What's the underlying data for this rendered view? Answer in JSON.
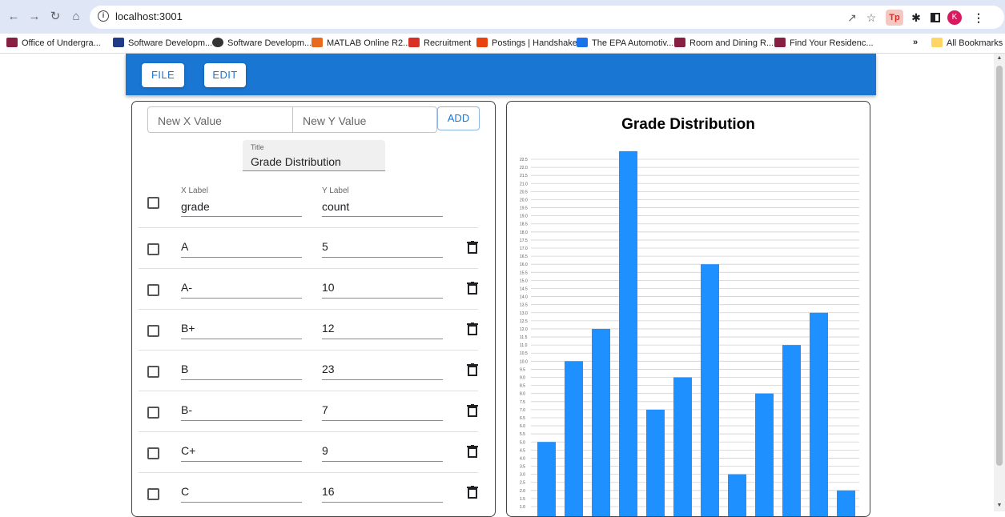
{
  "browser": {
    "url": "localhost:3001",
    "bookmarks": [
      {
        "label": "Office of Undergra...",
        "color": "#861f41"
      },
      {
        "label": "Software Developm...",
        "color": "#1f3c88"
      },
      {
        "label": "Software Developm...",
        "color": "#333333"
      },
      {
        "label": "MATLAB Online R2...",
        "color": "#e76a1f"
      },
      {
        "label": "Recruitment",
        "color": "#d93025"
      },
      {
        "label": "Postings | Handshake",
        "color": "#e8430f"
      },
      {
        "label": "The EPA Automotiv...",
        "color": "#1a73e8"
      },
      {
        "label": "Room and Dining R...",
        "color": "#861f41"
      },
      {
        "label": "Find Your Residenc...",
        "color": "#861f41"
      }
    ],
    "all_bookmarks": "All Bookmarks",
    "profile_initial": "K"
  },
  "appbar": {
    "file_label": "FILE",
    "edit_label": "EDIT",
    "color": "#1976d2"
  },
  "editor": {
    "x_placeholder": "New X Value",
    "y_placeholder": "New Y Value",
    "add_label": "ADD",
    "title_label": "Title",
    "title_value": "Grade Distribution",
    "x_label_caption": "X Label",
    "x_label_value": "grade",
    "y_label_caption": "Y Label",
    "y_label_value": "count",
    "rows": [
      {
        "x": "A",
        "y": "5"
      },
      {
        "x": "A-",
        "y": "10"
      },
      {
        "x": "B+",
        "y": "12"
      },
      {
        "x": "B",
        "y": "23"
      },
      {
        "x": "B-",
        "y": "7"
      },
      {
        "x": "C+",
        "y": "9"
      },
      {
        "x": "C",
        "y": "16"
      }
    ]
  },
  "chart_data": {
    "type": "bar",
    "title": "Grade Distribution",
    "values": [
      5,
      10,
      12,
      23,
      7,
      9,
      16,
      3,
      8,
      11,
      13,
      2
    ],
    "ylim": [
      1.0,
      22.5
    ],
    "ytick_step": 0.5,
    "grid": true,
    "bar_color": "#1e90ff"
  }
}
